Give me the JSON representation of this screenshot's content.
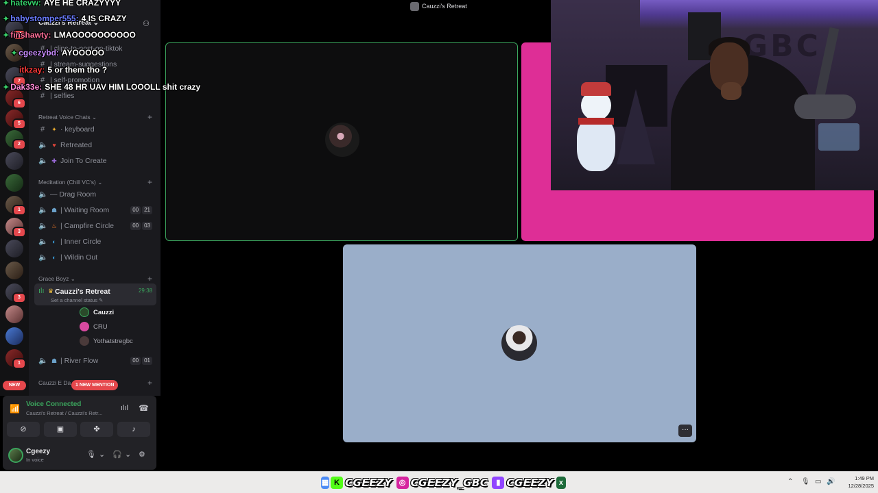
{
  "chat": [
    {
      "nick": "hatevw:",
      "text": "AYE HE CRAZYYYY",
      "color": "#35d26b"
    },
    {
      "nick": "babystomper555:",
      "text": "4 IS CRAZY",
      "color": "#6b7cff"
    },
    {
      "nick": "finshawty:",
      "text": "LMAOOOOOOOOOO",
      "color": "#ff6f9a"
    },
    {
      "nick": "cgeezybd:",
      "text": "AYOOOOO",
      "color": "#c98cff"
    },
    {
      "nick": "itkzay:",
      "text": "5 or them tho ?",
      "color": "#ff3b3b"
    },
    {
      "nick": "Dak33e:",
      "text": "SHE 48 HR UAV HIM LOOOLL shit crazy",
      "color": "#ff8ad8"
    }
  ],
  "server": {
    "name": "Cauzzi's Retreat",
    "partial_channels": [
      "| clips-to-post-on-tiktok",
      "| stream-suggestions",
      "| self-promotion",
      "| selfies"
    ],
    "categories": {
      "retreat_voice": "Retreat Voice Chats",
      "meditation": "Meditation (Chill VC's)",
      "grace_boyz": "Grace Boyz",
      "cauzzi_e": "Cauzzi E Da..."
    },
    "channels": {
      "keyboard": "keyboard",
      "retreated": "Retreated",
      "join_to_create": "Join To Create",
      "drag_room": "Drag Room",
      "waiting_room": "| Waiting Room",
      "campfire_circle": "| Campfire Circle",
      "inner_circle": "| Inner Circle",
      "wildin_out": "| Wildin Out",
      "river_flow": "| River Flow"
    },
    "counts": {
      "waiting_room": [
        "00",
        "21"
      ],
      "campfire_circle": [
        "00",
        "03"
      ],
      "river_flow": [
        "00",
        "01"
      ]
    },
    "active_vc": {
      "name": "Cauzzi's Retreat",
      "status": "Set a channel status",
      "timer": "29:38",
      "members": [
        "Cauzzi",
        "CRU",
        "Yothatstregbc"
      ]
    },
    "mention_pill": "1 NEW MENTION",
    "new_pill": "NEW",
    "rail_badges": [
      "16",
      "7",
      "6",
      "5",
      "2",
      "1",
      "3",
      "3",
      "1"
    ]
  },
  "voice_panel": {
    "status": "Voice Connected",
    "sub": "Cauzzi's Retreat / Cauzzi's Retr..."
  },
  "user": {
    "name": "Cgeezy",
    "state": "In voice"
  },
  "main": {
    "title": "Cauzzi's Retreat",
    "more_label": "···"
  },
  "webcam": {
    "wall_text": "GBC"
  },
  "taskbar": {
    "social": [
      "CGEEZY",
      "CGEEZY_GBC",
      "CGEEZY"
    ],
    "time": "1:49 PM",
    "date": "12/28/2025"
  },
  "colors": {
    "green": "#3ba55d",
    "pink_tile": "#de2e96",
    "blue_tile": "#9aaec9",
    "badge_red": "#e5484d"
  }
}
